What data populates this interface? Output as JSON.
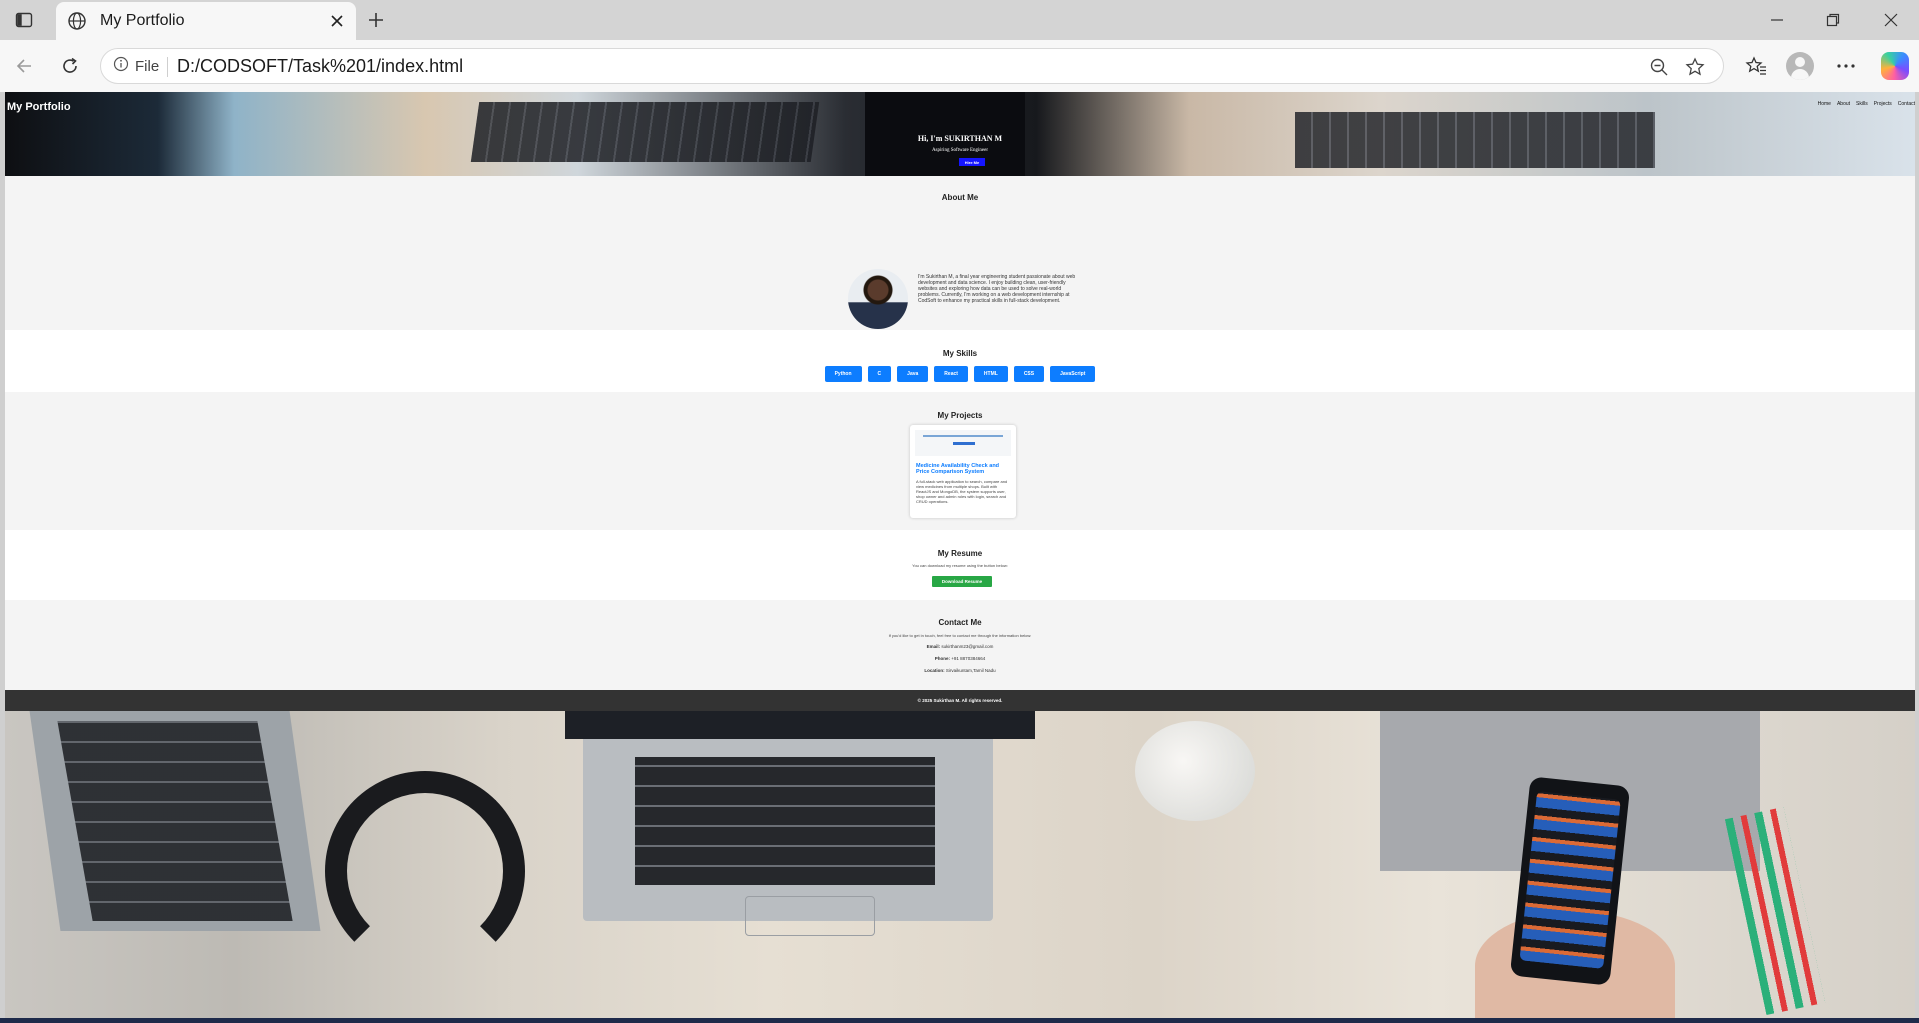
{
  "browser": {
    "tab_title": "My Portfolio",
    "info_label": "File",
    "url": "D:/CODSOFT/Task%201/index.html"
  },
  "site": {
    "brand": "My Portfolio",
    "nav": [
      "Home",
      "About",
      "Skills",
      "Projects",
      "Contact"
    ],
    "hero": {
      "greeting": "Hi, I'm SUKIRTHAN M",
      "role": "Aspiring Software Engineer",
      "cta": "Hire Me"
    },
    "about": {
      "title": "About Me",
      "text": "I'm Sukirthan M, a final year engineering student passionate about web development and data science. I enjoy building clean, user-friendly websites and exploring how data can be used to solve real-world problems. Currently, I'm working on a web development internship at CodSoft to enhance my practical skills in full-stack development."
    },
    "skills": {
      "title": "My Skills",
      "items": [
        "Python",
        "C",
        "Java",
        "React",
        "HTML",
        "CSS",
        "JavaScript"
      ]
    },
    "projects": {
      "title": "My Projects",
      "items": [
        {
          "title": "Medicine Availability Check and Price Comparison System",
          "description": "A full-stack web application to search, compare and view medicines from multiple shops. Built with ReactJS and MongoDB, the system supports user, shop owner and admin roles with login, search and CRUD operations."
        }
      ]
    },
    "resume": {
      "title": "My Resume",
      "text": "You can download my resume using the button below:",
      "button": "Download Resume"
    },
    "contact": {
      "title": "Contact Me",
      "text": "If you'd like to get in touch, feel free to contact me through the information below:",
      "email_label": "Email:",
      "email": "sukirthanm23@gmail.com",
      "phone_label": "Phone:",
      "phone": "+91 8870384664",
      "location_label": "Location:",
      "location": "Sirvaikuntam,Tamil Nadu"
    },
    "footer": "© 2025 Sukirthan M. All rights reserved."
  }
}
